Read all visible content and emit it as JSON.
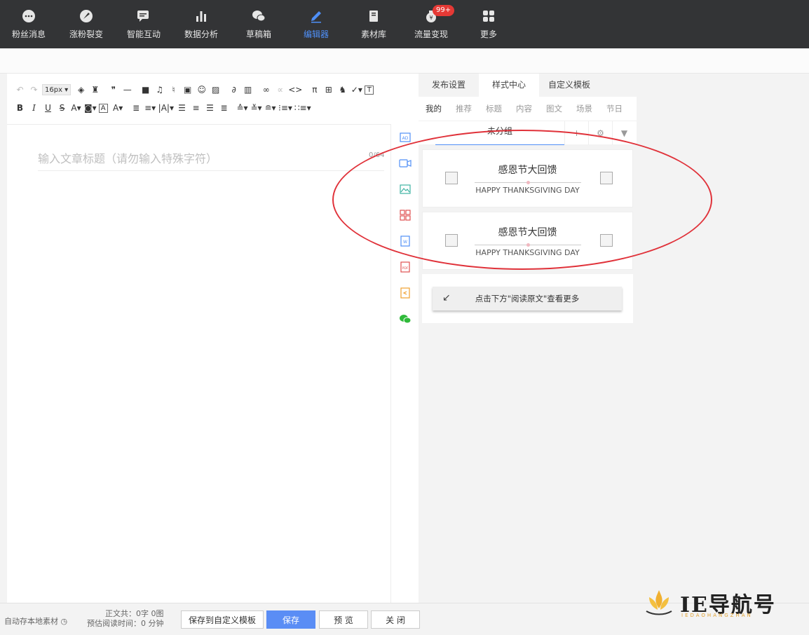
{
  "topnav": {
    "items": [
      {
        "label": "粉丝消息",
        "icon": "chat-bubble-icon",
        "active": false
      },
      {
        "label": "涨粉裂变",
        "icon": "rocket-icon",
        "active": false
      },
      {
        "label": "智能互动",
        "icon": "message-icon",
        "active": false
      },
      {
        "label": "数据分析",
        "icon": "bar-chart-icon",
        "active": false
      },
      {
        "label": "草稿箱",
        "icon": "wechat-icon",
        "active": false
      },
      {
        "label": "编辑器",
        "icon": "pencil-icon",
        "active": true
      },
      {
        "label": "素材库",
        "icon": "book-icon",
        "active": false
      },
      {
        "label": "流量变现",
        "icon": "money-bag-icon",
        "active": false,
        "badge": "99+"
      },
      {
        "label": "更多",
        "icon": "grid-icon",
        "active": false
      }
    ]
  },
  "toolbar": {
    "font_size": "16px"
  },
  "editor": {
    "title_placeholder": "输入文章标题（请勿输入特殊字符）",
    "title_counter": "0/64"
  },
  "panel": {
    "tabs": [
      "发布设置",
      "样式中心",
      "自定义模板"
    ],
    "active_tab": "样式中心",
    "categories": [
      "我的",
      "推荐",
      "标题",
      "内容",
      "图文",
      "场景",
      "节日"
    ],
    "active_category": "我的",
    "group_select": "未分组",
    "cards": [
      {
        "title": "感恩节大回馈",
        "subtitle": "HAPPY THANKSGIVING DAY"
      },
      {
        "title": "感恩节大回馈",
        "subtitle": "HAPPY THANKSGIVING DAY"
      }
    ],
    "read_more": "点击下方\"阅读原文\"查看更多"
  },
  "footer": {
    "autosave": "自动存本地素材",
    "stats_line1": "正文共：0字 0图",
    "stats_line2": "预估阅读时间：0 分钟",
    "save_template": "保存到自定义模板",
    "save": "保存",
    "preview": "预 览",
    "close": "关 闭"
  },
  "watermark": {
    "brand": "IE导航号",
    "sub": "IEDAOHANGZHAN"
  },
  "colors": {
    "nav_bg": "#333436",
    "accent": "#4f8ff7",
    "badge": "#e53935",
    "annotation": "#e0323a"
  }
}
